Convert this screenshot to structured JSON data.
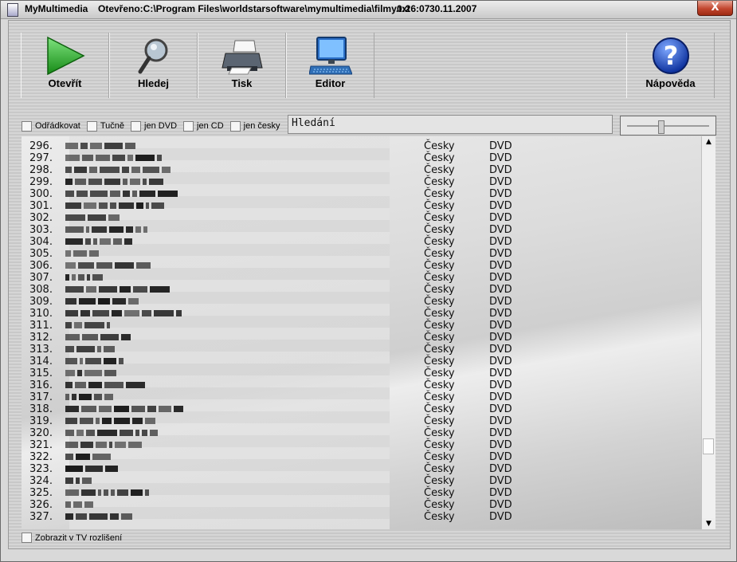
{
  "window": {
    "app_name": "MyMultimedia",
    "path_info": "Otevřeno:C:\\Program Files\\worldstarsoftware\\mymultimedia\\filmy.txt",
    "time": "0:26:07",
    "date": "30.11.2007",
    "close_label": "X"
  },
  "toolbar": {
    "open_label": "Otevřít",
    "search_label": "Hledej",
    "print_label": "Tisk",
    "editor_label": "Editor",
    "help_label": "Nápověda"
  },
  "filters": {
    "wrap": "Odřádkovat",
    "bold": "Tučně",
    "dvd_only": "jen DVD",
    "cd_only": "jen CD",
    "czech_only": "jen česky"
  },
  "search": {
    "value": "Hledání"
  },
  "list": {
    "rows": [
      {
        "num": "296.",
        "lang": "Česky",
        "media": "DVD"
      },
      {
        "num": "297.",
        "lang": "Česky",
        "media": "DVD"
      },
      {
        "num": "298.",
        "lang": "Česky",
        "media": "DVD"
      },
      {
        "num": "299.",
        "lang": "Česky",
        "media": "DVD"
      },
      {
        "num": "300.",
        "lang": "Česky",
        "media": "DVD"
      },
      {
        "num": "301.",
        "lang": "Česky",
        "media": "DVD"
      },
      {
        "num": "302.",
        "lang": "Česky",
        "media": "DVD"
      },
      {
        "num": "303.",
        "lang": "Česky",
        "media": "DVD"
      },
      {
        "num": "304.",
        "lang": "Česky",
        "media": "DVD"
      },
      {
        "num": "305.",
        "lang": "Česky",
        "media": "DVD"
      },
      {
        "num": "306.",
        "lang": "Česky",
        "media": "DVD"
      },
      {
        "num": "307.",
        "lang": "Česky",
        "media": "DVD"
      },
      {
        "num": "308.",
        "lang": "Česky",
        "media": "DVD"
      },
      {
        "num": "309.",
        "lang": "Česky",
        "media": "DVD"
      },
      {
        "num": "310.",
        "lang": "Česky",
        "media": "DVD"
      },
      {
        "num": "311.",
        "lang": "Česky",
        "media": "DVD"
      },
      {
        "num": "312.",
        "lang": "Česky",
        "media": "DVD"
      },
      {
        "num": "313.",
        "lang": "Česky",
        "media": "DVD"
      },
      {
        "num": "314.",
        "lang": "Česky",
        "media": "DVD"
      },
      {
        "num": "315.",
        "lang": "Česky",
        "media": "DVD"
      },
      {
        "num": "316.",
        "lang": "Česky",
        "media": "DVD"
      },
      {
        "num": "317.",
        "lang": "Česky",
        "media": "DVD"
      },
      {
        "num": "318.",
        "lang": "Česky",
        "media": "DVD"
      },
      {
        "num": "319.",
        "lang": "Česky",
        "media": "DVD"
      },
      {
        "num": "320.",
        "lang": "Česky",
        "media": "DVD"
      },
      {
        "num": "321.",
        "lang": "Česky",
        "media": "DVD"
      },
      {
        "num": "322.",
        "lang": "Česky",
        "media": "DVD"
      },
      {
        "num": "323.",
        "lang": "Česky",
        "media": "DVD"
      },
      {
        "num": "324.",
        "lang": "Česky",
        "media": "DVD"
      },
      {
        "num": "325.",
        "lang": "Česky",
        "media": "DVD"
      },
      {
        "num": "326.",
        "lang": "Česky",
        "media": "DVD"
      },
      {
        "num": "327.",
        "lang": "Česky",
        "media": "DVD"
      }
    ]
  },
  "status": {
    "tv_mode": "Zobrazit v TV rozlišení"
  },
  "icons": {
    "open": "play-arrow-icon",
    "search": "magnifier-icon",
    "print": "printer-icon",
    "editor": "monitor-keyboard-icon",
    "help": "question-mark-icon"
  },
  "colors": {
    "play_green": "#2fb52f",
    "help_blue": "#1c4fd0"
  }
}
